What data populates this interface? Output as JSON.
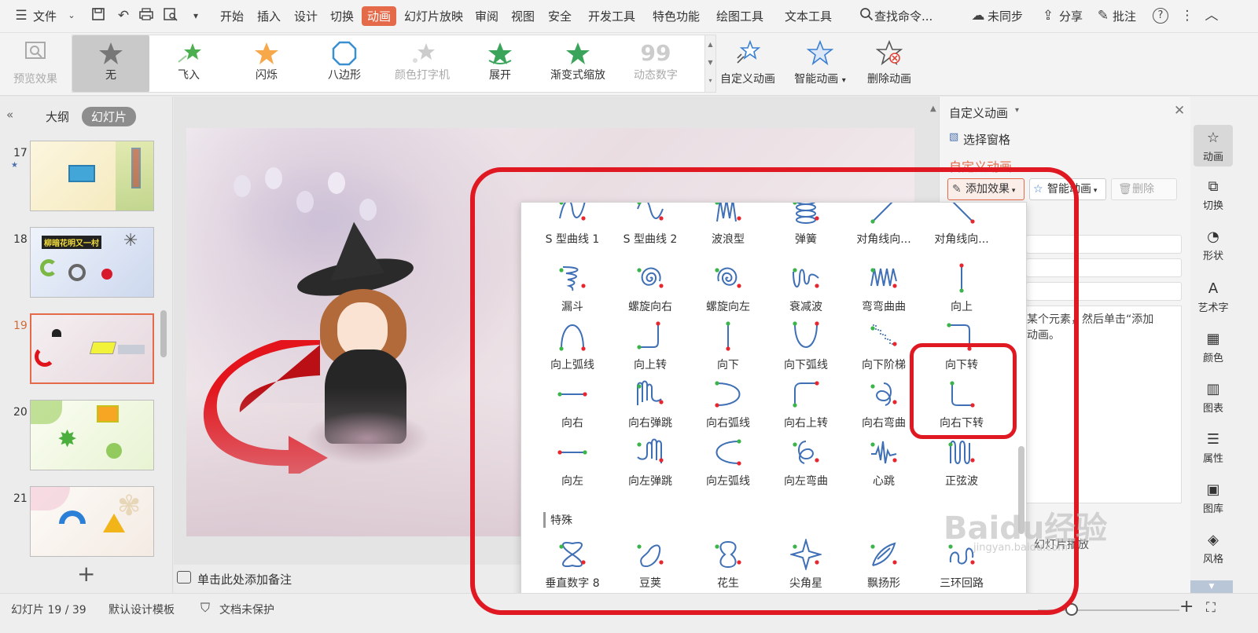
{
  "menubar": {
    "file": "文件",
    "tabs": [
      "开始",
      "插入",
      "设计",
      "切换",
      "动画",
      "幻灯片放映",
      "审阅",
      "视图",
      "安全",
      "开发工具",
      "特色功能",
      "绘图工具",
      "文本工具"
    ],
    "search": "查找命令...",
    "sync": "未同步",
    "share": "分享",
    "comment": "批注"
  },
  "ribbon": {
    "preview": "预览效果",
    "gallery": [
      "无",
      "飞入",
      "闪烁",
      "八边形",
      "颜色打字机",
      "展开",
      "渐变式缩放",
      "动态数字"
    ],
    "custom": "自定义动画",
    "smart": "智能动画",
    "delete": "删除动画"
  },
  "leftpanel": {
    "tab_outline": "大纲",
    "tab_slides": "幻灯片",
    "slides": [
      {
        "num": "17"
      },
      {
        "num": "18",
        "text": "柳暗花明又一村"
      },
      {
        "num": "19"
      },
      {
        "num": "20"
      },
      {
        "num": "21"
      }
    ],
    "add": "+"
  },
  "notes": "单击此处添加备注",
  "taskpane": {
    "title": "自定义动画",
    "select_pane": "选择窗格",
    "subtitle": "自定义动画",
    "add_effect": "添加效果",
    "smart": "智能动画",
    "delete": "删除",
    "hint": "某个元素，然后单击“添加",
    "hint2": "动画。",
    "play": "幻灯片播放"
  },
  "popup": {
    "rows": [
      [
        "S 型曲线 1",
        "S 型曲线 2",
        "波浪型",
        "弹簧",
        "对角线向...",
        "对角线向..."
      ],
      [
        "漏斗",
        "螺旋向右",
        "螺旋向左",
        "衰减波",
        "弯弯曲曲",
        "向上"
      ],
      [
        "向上弧线",
        "向上转",
        "向下",
        "向下弧线",
        "向下阶梯",
        "向下转"
      ],
      [
        "向右",
        "向右弹跳",
        "向右弧线",
        "向右上转",
        "向右弯曲",
        "向右下转"
      ],
      [
        "向左",
        "向左弹跳",
        "向左弧线",
        "向左弯曲",
        "心跳",
        "正弦波"
      ]
    ],
    "section": "特殊",
    "special": [
      "垂直数字 8",
      "豆荚",
      "花生",
      "尖角星",
      "飘扬形",
      "三环回路"
    ]
  },
  "rside": [
    "动画",
    "切换",
    "形状",
    "艺术字",
    "颜色",
    "图表",
    "属性",
    "图库",
    "风格"
  ],
  "statusbar": {
    "slide": "幻灯片 19 / 39",
    "template": "默认设计模板",
    "protect": "文档未保护"
  },
  "watermark": {
    "brand": "Baidu经验",
    "url": "jingyan.baidu.com"
  },
  "colors": {
    "accent": "#e46a4a",
    "highlight": "#e01822",
    "path": "#3f6fb5"
  }
}
